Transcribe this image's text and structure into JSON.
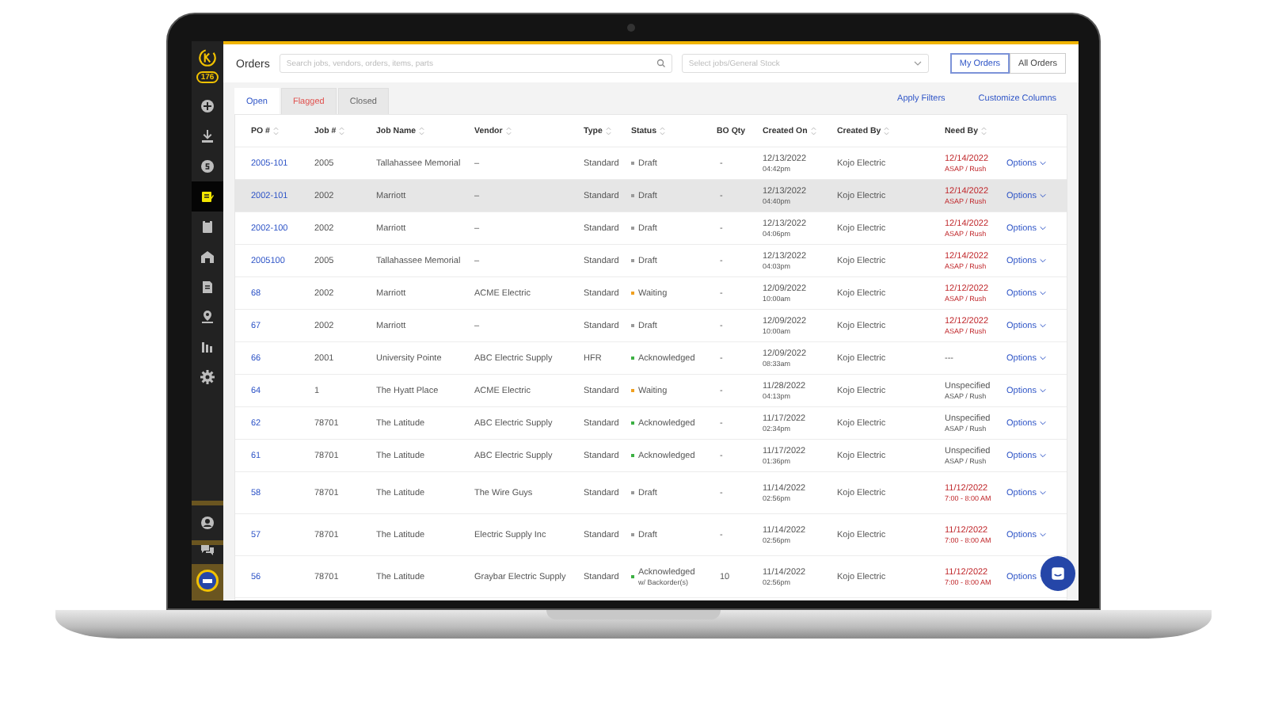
{
  "sidebar": {
    "badge": "176",
    "items": [
      {
        "selected": false
      },
      {
        "selected": false
      },
      {
        "selected": false
      },
      {
        "selected": true
      },
      {
        "selected": false
      },
      {
        "selected": false
      },
      {
        "selected": false
      },
      {
        "selected": false
      },
      {
        "selected": false
      },
      {
        "selected": false
      }
    ]
  },
  "header": {
    "title": "Orders",
    "search": {
      "placeholder": "Search jobs, vendors, orders, items, parts"
    },
    "job_select": {
      "placeholder": "Select jobs/General Stock"
    },
    "scope_buttons": [
      {
        "label": "My Orders",
        "selected": true
      },
      {
        "label": "All Orders",
        "selected": false
      }
    ]
  },
  "tabs": [
    {
      "label": "Open",
      "selected": true,
      "color": "#2f55c7"
    },
    {
      "label": "Flagged",
      "selected": false,
      "color": "#e0524f"
    },
    {
      "label": "Closed",
      "selected": false,
      "color": "#666666"
    }
  ],
  "actions": [
    "Apply Filters",
    "Customize Columns"
  ],
  "table": {
    "columns": [
      {
        "label": "PO #",
        "sortable": true
      },
      {
        "label": "Job #",
        "sortable": true
      },
      {
        "label": "Job Name",
        "sortable": true
      },
      {
        "label": "Vendor",
        "sortable": true
      },
      {
        "label": "Type",
        "sortable": true
      },
      {
        "label": "Status",
        "sortable": true
      },
      {
        "label": "BO Qty",
        "sortable": false
      },
      {
        "label": "Created On",
        "sortable": true
      },
      {
        "label": "Created By",
        "sortable": true
      },
      {
        "label": "Need By",
        "sortable": true
      }
    ],
    "rows": [
      {
        "po": "2005-101",
        "job": "2005",
        "job_name": "Tallahassee Memorial",
        "vendor": "–",
        "type": "Standard",
        "status": "Draft",
        "color": "#9a9a9a",
        "bo_qty": "-",
        "created_date": "12/13/2022",
        "created_time": "04:42pm",
        "created_by": "Kojo Electric",
        "need_by": "12/14/2022",
        "need_note": "ASAP / Rush",
        "urgent": true,
        "highlighted": false,
        "action": "Options"
      },
      {
        "po": "2002-101",
        "job": "2002",
        "job_name": "Marriott",
        "vendor": "–",
        "type": "Standard",
        "status": "Draft",
        "color": "#9a9a9a",
        "bo_qty": "-",
        "created_date": "12/13/2022",
        "created_time": "04:40pm",
        "created_by": "Kojo Electric",
        "need_by": "12/14/2022",
        "need_note": "ASAP / Rush",
        "urgent": true,
        "highlighted": true,
        "action": "Options"
      },
      {
        "po": "2002-100",
        "job": "2002",
        "job_name": "Marriott",
        "vendor": "–",
        "type": "Standard",
        "status": "Draft",
        "color": "#9a9a9a",
        "bo_qty": "-",
        "created_date": "12/13/2022",
        "created_time": "04:06pm",
        "created_by": "Kojo Electric",
        "need_by": "12/14/2022",
        "need_note": "ASAP / Rush",
        "urgent": true,
        "highlighted": false,
        "action": "Options"
      },
      {
        "po": "2005100",
        "job": "2005",
        "job_name": "Tallahassee Memorial",
        "vendor": "–",
        "type": "Standard",
        "status": "Draft",
        "color": "#9a9a9a",
        "bo_qty": "-",
        "created_date": "12/13/2022",
        "created_time": "04:03pm",
        "created_by": "Kojo Electric",
        "need_by": "12/14/2022",
        "need_note": "ASAP / Rush",
        "urgent": true,
        "highlighted": false,
        "action": "Options"
      },
      {
        "po": "68",
        "job": "2002",
        "job_name": "Marriott",
        "vendor": "ACME Electric",
        "type": "Standard",
        "status": "Waiting",
        "color": "#f0a020",
        "bo_qty": "-",
        "created_date": "12/09/2022",
        "created_time": "10:00am",
        "created_by": "Kojo Electric",
        "need_by": "12/12/2022",
        "need_note": "ASAP / Rush",
        "urgent": true,
        "highlighted": false,
        "action": "Options"
      },
      {
        "po": "67",
        "job": "2002",
        "job_name": "Marriott",
        "vendor": "–",
        "type": "Standard",
        "status": "Draft",
        "color": "#9a9a9a",
        "bo_qty": "-",
        "created_date": "12/09/2022",
        "created_time": "10:00am",
        "created_by": "Kojo Electric",
        "need_by": "12/12/2022",
        "need_note": "ASAP / Rush",
        "urgent": true,
        "highlighted": false,
        "action": "Options"
      },
      {
        "po": "66",
        "job": "2001",
        "job_name": "University Pointe",
        "vendor": "ABC Electric Supply",
        "type": "HFR",
        "status": "Acknowledged",
        "color": "#3cb043",
        "bo_qty": "-",
        "created_date": "12/09/2022",
        "created_time": "08:33am",
        "created_by": "Kojo Electric",
        "need_by": "---",
        "urgent": false,
        "highlighted": false,
        "action": "Options"
      },
      {
        "po": "64",
        "job": "1",
        "job_name": "The Hyatt Place",
        "vendor": "ACME Electric",
        "type": "Standard",
        "status": "Waiting",
        "color": "#f0a020",
        "bo_qty": "-",
        "created_date": "11/28/2022",
        "created_time": "04:13pm",
        "created_by": "Kojo Electric",
        "need_by": "Unspecified",
        "need_note": "ASAP / Rush",
        "urgent": false,
        "highlighted": false,
        "action": "Options"
      },
      {
        "po": "62",
        "job": "78701",
        "job_name": "The Latitude",
        "vendor": "ABC Electric Supply",
        "type": "Standard",
        "status": "Acknowledged",
        "color": "#3cb043",
        "bo_qty": "-",
        "created_date": "11/17/2022",
        "created_time": "02:34pm",
        "created_by": "Kojo Electric",
        "need_by": "Unspecified",
        "need_note": "ASAP / Rush",
        "urgent": false,
        "highlighted": false,
        "action": "Options"
      },
      {
        "po": "61",
        "job": "78701",
        "job_name": "The Latitude",
        "vendor": "ABC Electric Supply",
        "type": "Standard",
        "status": "Acknowledged",
        "color": "#3cb043",
        "bo_qty": "-",
        "created_date": "11/17/2022",
        "created_time": "01:36pm",
        "created_by": "Kojo Electric",
        "need_by": "Unspecified",
        "need_note": "ASAP / Rush",
        "urgent": false,
        "highlighted": false,
        "action": "Options"
      },
      {
        "po": "58",
        "job": "78701",
        "job_name": "The Latitude",
        "vendor": "The Wire Guys",
        "type": "Standard",
        "status": "Draft",
        "color": "#9a9a9a",
        "bo_qty": "-",
        "created_date": "11/14/2022",
        "created_time": "02:56pm",
        "created_by": "Kojo Electric",
        "need_by": "11/12/2022",
        "need_note": "7:00 - 8:00 AM",
        "urgent": true,
        "highlighted": false,
        "action": "Options"
      },
      {
        "po": "57",
        "job": "78701",
        "job_name": "The Latitude",
        "vendor": "Electric Supply Inc",
        "type": "Standard",
        "status": "Draft",
        "color": "#9a9a9a",
        "bo_qty": "-",
        "created_date": "11/14/2022",
        "created_time": "02:56pm",
        "created_by": "Kojo Electric",
        "need_by": "11/12/2022",
        "need_note": "7:00 - 8:00 AM",
        "urgent": true,
        "highlighted": false,
        "action": "Options"
      },
      {
        "po": "56",
        "job": "78701",
        "job_name": "The Latitude",
        "vendor": "Graybar Electric Supply",
        "type": "Standard",
        "status": "Acknowledged",
        "status_note": "w/ Backorder(s)",
        "color": "#3cb043",
        "bo_qty": "10",
        "created_date": "11/14/2022",
        "created_time": "02:56pm",
        "created_by": "Kojo Electric",
        "need_by": "11/12/2022",
        "need_note": "7:00 - 8:00 AM",
        "urgent": true,
        "highlighted": false,
        "action": "Options"
      }
    ]
  }
}
